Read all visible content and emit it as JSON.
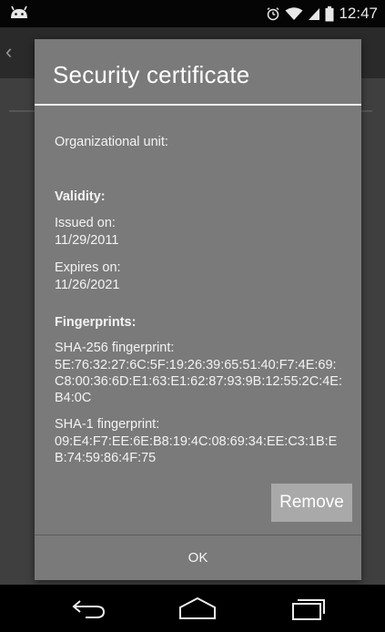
{
  "status_bar": {
    "time": "12:47",
    "icons": [
      "android-icon",
      "alarm-icon",
      "wifi-icon",
      "signal-icon",
      "battery-icon"
    ]
  },
  "dialog": {
    "title": "Security certificate",
    "org_unit_label": "Organizational unit:",
    "validity_heading": "Validity:",
    "issued_label": "Issued on:",
    "issued_value": "11/29/2011",
    "expires_label": "Expires on:",
    "expires_value": "11/26/2021",
    "fingerprints_heading": "Fingerprints:",
    "sha256_label": "SHA-256 fingerprint:",
    "sha256_value": "5E:76:32:27:6C:5F:19:26:39:65:51:40:F7:4E:69:C8:00:36:6D:E1:63:E1:62:87:93:9B:12:55:2C:4E:B4:0C",
    "sha1_label": "SHA-1 fingerprint:",
    "sha1_value": "09:E4:F7:EE:6E:B8:19:4C:08:69:34:EE:C3:1B:EB:74:59:86:4F:75",
    "remove_label": "Remove",
    "ok_label": "OK"
  },
  "nav_bar": {
    "icons": [
      "back-icon",
      "home-icon",
      "recents-icon"
    ]
  }
}
